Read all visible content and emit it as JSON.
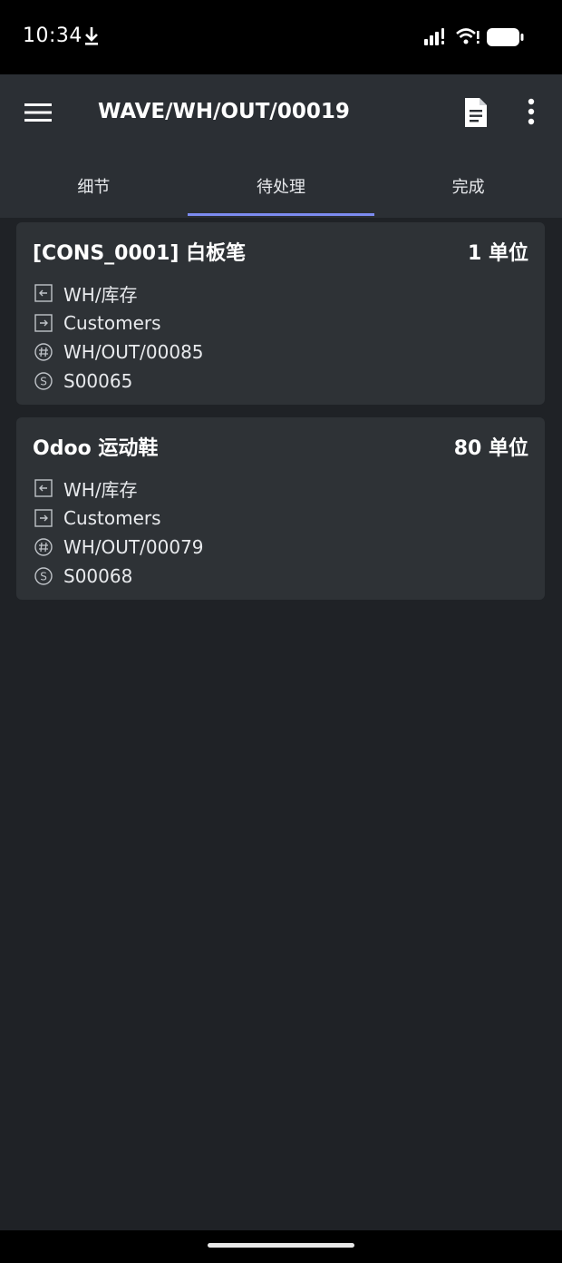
{
  "status_bar": {
    "time": "10:34",
    "battery_level": 1.0
  },
  "app_bar": {
    "title": "WAVE/WH/OUT/00019",
    "tabs": [
      {
        "label": "细节",
        "active": false
      },
      {
        "label": "待处理",
        "active": true
      },
      {
        "label": "完成",
        "active": false
      }
    ]
  },
  "colors": {
    "background": "#1f2226",
    "app_bar": "#2b2f34",
    "card": "#2e3236",
    "tab_indicator": "#7c8cf0"
  },
  "icons": {
    "source": "arrow-left-box-icon",
    "destination": "arrow-right-box-icon",
    "reference": "hash-circle-icon",
    "sale_order": "s-circle-icon"
  },
  "moves": [
    {
      "product": "[CONS_0001] 白板笔",
      "quantity": "1 单位",
      "source_location": "WH/库存",
      "destination_location": "Customers",
      "picking": "WH/OUT/00085",
      "origin": "S00065"
    },
    {
      "product": "Odoo 运动鞋",
      "quantity": "80 单位",
      "source_location": "WH/库存",
      "destination_location": "Customers",
      "picking": "WH/OUT/00079",
      "origin": "S00068"
    }
  ]
}
